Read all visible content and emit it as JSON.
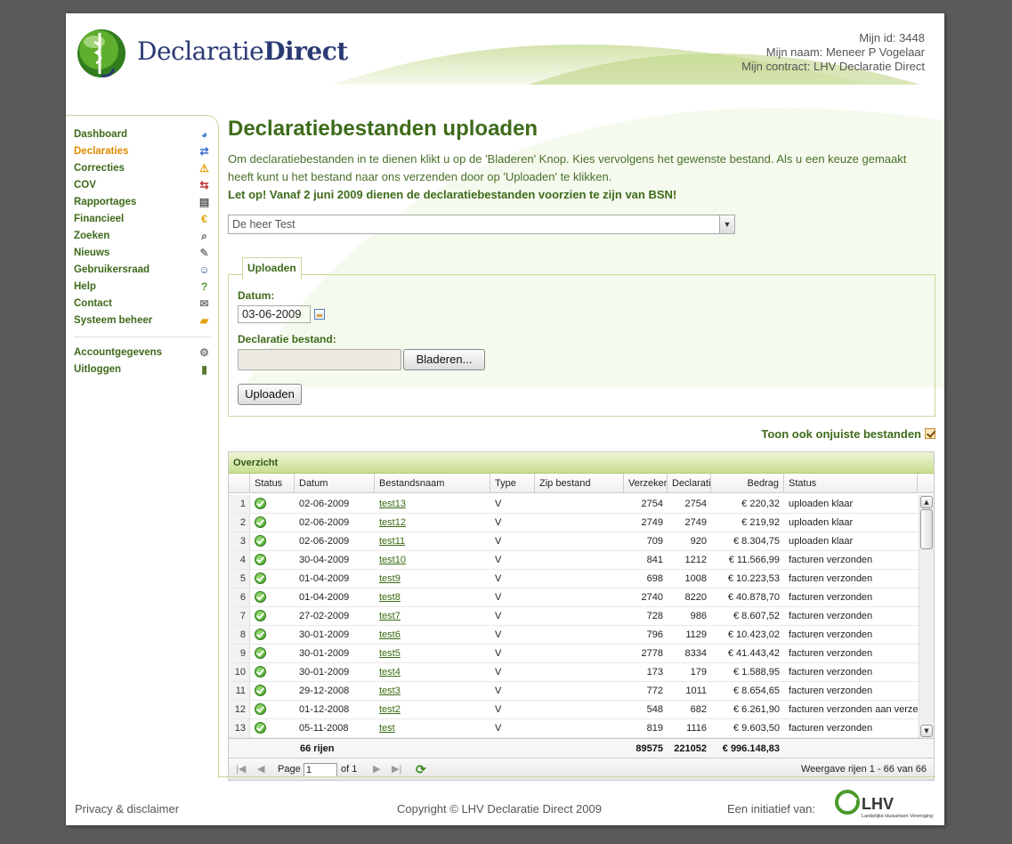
{
  "brand": {
    "logo_regular": "Declaratie",
    "logo_bold": "Direct"
  },
  "user_info": {
    "id_label": "Mijn id:",
    "id_value": "3448",
    "name_label": "Mijn naam:",
    "name_value": "Meneer P Vogelaar",
    "contract_label": "Mijn contract:",
    "contract_value": "LHV Declaratie Direct"
  },
  "sidebar": {
    "items": [
      {
        "label": "Dashboard",
        "icon": "chart-pie-icon",
        "glyph": "◕"
      },
      {
        "label": "Declaraties",
        "icon": "file-exchange-icon",
        "glyph": "⇄",
        "active": true
      },
      {
        "label": "Correcties",
        "icon": "warning-icon",
        "glyph": "⚠"
      },
      {
        "label": "COV",
        "icon": "arrows-icon",
        "glyph": "⇆"
      },
      {
        "label": "Rapportages",
        "icon": "report-icon",
        "glyph": "▤"
      },
      {
        "label": "Financieel",
        "icon": "euro-icon",
        "glyph": "€"
      },
      {
        "label": "Zoeken",
        "icon": "search-icon",
        "glyph": "⌕"
      },
      {
        "label": "Nieuws",
        "icon": "news-icon",
        "glyph": "✎"
      },
      {
        "label": "Gebruikersraad",
        "icon": "user-icon",
        "glyph": "☺"
      },
      {
        "label": "Help",
        "icon": "help-icon",
        "glyph": "?"
      },
      {
        "label": "Contact",
        "icon": "mail-icon",
        "glyph": "✉"
      },
      {
        "label": "Systeem beheer",
        "icon": "folder-icon",
        "glyph": "▰"
      }
    ],
    "account_items": [
      {
        "label": "Accountgegevens",
        "icon": "gear-icon",
        "glyph": "⚙"
      },
      {
        "label": "Uitloggen",
        "icon": "logout-door-icon",
        "glyph": "▮"
      }
    ]
  },
  "main": {
    "title": "Declaratiebestanden uploaden",
    "intro": "Om declaratiebestanden in te dienen klikt u op de 'Bladeren' Knop. Kies vervolgens het gewenste bestand. Als u een keuze gemaakt heeft kunt u het bestand naar ons verzenden door op 'Uploaden' te klikken.",
    "warning": "Let op! Vanaf 2 juni 2009 dienen de declaratiebestanden voorzien te zijn van BSN!",
    "person_select": "De heer Test"
  },
  "upload": {
    "tab_label": "Uploaden",
    "date_label": "Datum:",
    "date_value": "03-06-2009",
    "file_label": "Declaratie bestand:",
    "browse_label": "Bladeren...",
    "upload_label": "Uploaden"
  },
  "toggle": {
    "label": "Toon ook onjuiste bestanden",
    "checked": true
  },
  "grid": {
    "title": "Overzicht",
    "columns": [
      "Status",
      "Datum",
      "Bestandsnaam",
      "Type",
      "Zip bestand",
      "Verzekerden",
      "Declaraties",
      "Bedrag",
      "Status"
    ],
    "rows": [
      {
        "n": "1",
        "datum": "02-06-2009",
        "bestand": "test13",
        "type": "V",
        "zip": "",
        "verz": "2754",
        "decl": "2754",
        "bedrag": "€ 220,32",
        "status": "uploaden klaar"
      },
      {
        "n": "2",
        "datum": "02-06-2009",
        "bestand": "test12",
        "type": "V",
        "zip": "",
        "verz": "2749",
        "decl": "2749",
        "bedrag": "€ 219,92",
        "status": "uploaden klaar"
      },
      {
        "n": "3",
        "datum": "02-06-2009",
        "bestand": "test11",
        "type": "V",
        "zip": "",
        "verz": "709",
        "decl": "920",
        "bedrag": "€ 8.304,75",
        "status": "uploaden klaar"
      },
      {
        "n": "4",
        "datum": "30-04-2009",
        "bestand": "test10",
        "type": "V",
        "zip": "",
        "verz": "841",
        "decl": "1212",
        "bedrag": "€ 11.566,99",
        "status": "facturen verzonden"
      },
      {
        "n": "5",
        "datum": "01-04-2009",
        "bestand": "test9",
        "type": "V",
        "zip": "",
        "verz": "698",
        "decl": "1008",
        "bedrag": "€ 10.223,53",
        "status": "facturen verzonden"
      },
      {
        "n": "6",
        "datum": "01-04-2009",
        "bestand": "test8",
        "type": "V",
        "zip": "",
        "verz": "2740",
        "decl": "8220",
        "bedrag": "€ 40.878,70",
        "status": "facturen verzonden"
      },
      {
        "n": "7",
        "datum": "27-02-2009",
        "bestand": "test7",
        "type": "V",
        "zip": "",
        "verz": "728",
        "decl": "986",
        "bedrag": "€ 8.607,52",
        "status": "facturen verzonden"
      },
      {
        "n": "8",
        "datum": "30-01-2009",
        "bestand": "test6",
        "type": "V",
        "zip": "",
        "verz": "796",
        "decl": "1129",
        "bedrag": "€ 10.423,02",
        "status": "facturen verzonden"
      },
      {
        "n": "9",
        "datum": "30-01-2009",
        "bestand": "test5",
        "type": "V",
        "zip": "",
        "verz": "2778",
        "decl": "8334",
        "bedrag": "€ 41.443,42",
        "status": "facturen verzonden"
      },
      {
        "n": "10",
        "datum": "30-01-2009",
        "bestand": "test4",
        "type": "V",
        "zip": "",
        "verz": "173",
        "decl": "179",
        "bedrag": "€ 1.588,95",
        "status": "facturen verzonden"
      },
      {
        "n": "11",
        "datum": "29-12-2008",
        "bestand": "test3",
        "type": "V",
        "zip": "",
        "verz": "772",
        "decl": "1011",
        "bedrag": "€ 8.654,65",
        "status": "facturen verzonden"
      },
      {
        "n": "12",
        "datum": "01-12-2008",
        "bestand": "test2",
        "type": "V",
        "zip": "",
        "verz": "548",
        "decl": "682",
        "bedrag": "€ 6.261,90",
        "status": "facturen verzonden aan verzekeraar"
      },
      {
        "n": "13",
        "datum": "05-11-2008",
        "bestand": "test",
        "type": "V",
        "zip": "",
        "verz": "819",
        "decl": "1116",
        "bedrag": "€ 9.603,50",
        "status": "facturen verzonden"
      }
    ],
    "totals": {
      "rows_label": "66 rijen",
      "verz": "89575",
      "decl": "221052",
      "bedrag": "€ 996.148,83"
    },
    "pager": {
      "page_label": "Page",
      "page_value": "1",
      "of_label": "of 1",
      "summary": "Weergave rijen 1 - 66 van 66"
    }
  },
  "footer": {
    "privacy": "Privacy & disclaimer",
    "copyright": "Copyright © LHV Declaratie Direct 2009",
    "initiative": "Een initiatief van:",
    "lhv": "LHV",
    "lhv_sub": "Landelijke Huisartsen Vereniging"
  }
}
